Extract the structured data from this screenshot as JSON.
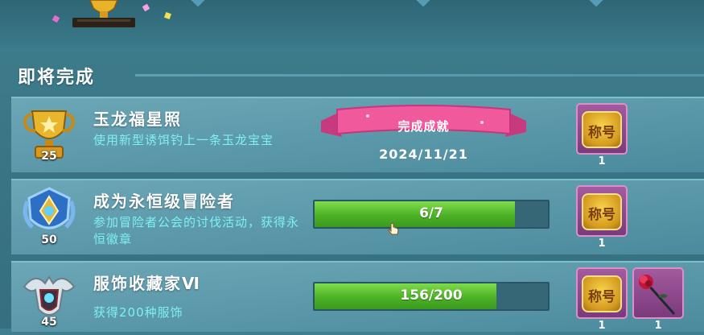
{
  "section": {
    "title": "即将完成"
  },
  "colors": {
    "accent_text": "#7ff0f0",
    "progress_green": "#4cb127",
    "reward_bg": "#8a4a8a"
  },
  "achievements": [
    {
      "title": "玉龙福星照",
      "badge_level": "25",
      "badge_icon": "gold-trophy-icon",
      "description": "使用新型诱饵钓上一条玉龙宝宝",
      "status_ribbon": "完成成就",
      "completed_date": "2024/11/21",
      "rewards": [
        {
          "label": "称号",
          "icon": "title-plate-icon",
          "count": "1"
        }
      ]
    },
    {
      "title": "成为永恒级冒险者",
      "badge_level": "50",
      "badge_icon": "blue-shield-emblem-icon",
      "description": "参加冒险者公会的讨伐活动，获得永恒徽章",
      "progress_text": "6/7",
      "progress_fraction": 0.857,
      "rewards": [
        {
          "label": "称号",
          "icon": "title-plate-icon",
          "count": "1"
        }
      ]
    },
    {
      "title": "服饰收藏家Ⅵ",
      "badge_level": "45",
      "badge_icon": "winged-crest-icon",
      "description": "获得200种服饰",
      "progress_text": "156/200",
      "progress_fraction": 0.78,
      "rewards": [
        {
          "label": "称号",
          "icon": "title-plate-icon",
          "count": "1"
        },
        {
          "icon": "red-rose-icon",
          "count": "1"
        }
      ]
    }
  ]
}
